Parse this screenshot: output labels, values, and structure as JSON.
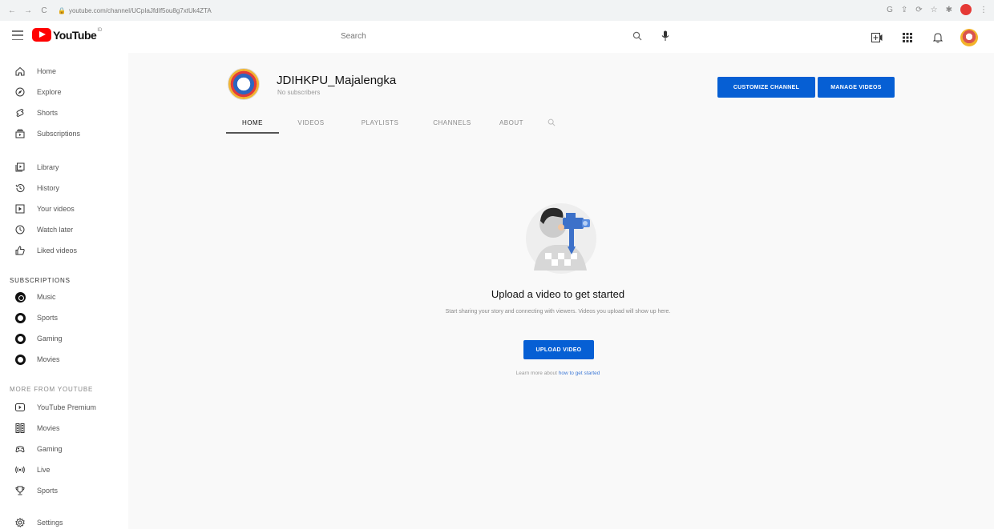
{
  "browser": {
    "url": "youtube.com/channel/UCpIaJfdIf5ou8g7xtUk4ZTA"
  },
  "header": {
    "logo_text": "YouTube",
    "logo_sup": "ID",
    "search_placeholder": "Search"
  },
  "sidebar": {
    "main": [
      {
        "label": "Home",
        "icon": "home-icon"
      },
      {
        "label": "Explore",
        "icon": "explore-icon"
      },
      {
        "label": "Shorts",
        "icon": "shorts-icon"
      },
      {
        "label": "Subscriptions",
        "icon": "subscriptions-icon"
      }
    ],
    "library": [
      {
        "label": "Library",
        "icon": "library-icon"
      },
      {
        "label": "History",
        "icon": "history-icon"
      },
      {
        "label": "Your videos",
        "icon": "your-videos-icon"
      },
      {
        "label": "Watch later",
        "icon": "watch-later-icon"
      },
      {
        "label": "Liked videos",
        "icon": "liked-videos-icon"
      }
    ],
    "subscriptions_heading": "SUBSCRIPTIONS",
    "subscriptions": [
      {
        "label": "Music"
      },
      {
        "label": "Sports"
      },
      {
        "label": "Gaming"
      },
      {
        "label": "Movies"
      }
    ],
    "more_heading": "MORE FROM YOUTUBE",
    "more": [
      {
        "label": "YouTube Premium",
        "icon": "youtube-premium-icon"
      },
      {
        "label": "Movies",
        "icon": "movies-icon"
      },
      {
        "label": "Gaming",
        "icon": "gaming-icon"
      },
      {
        "label": "Live",
        "icon": "live-icon"
      },
      {
        "label": "Sports",
        "icon": "sports-icon"
      }
    ],
    "settings": "Settings"
  },
  "channel": {
    "name": "JDIHKPU_Majalengka",
    "subscribers": "No subscribers",
    "customize_label": "CUSTOMIZE CHANNEL",
    "manage_label": "MANAGE VIDEOS",
    "tabs": [
      "HOME",
      "VIDEOS",
      "PLAYLISTS",
      "CHANNELS",
      "ABOUT"
    ],
    "active_tab": "HOME"
  },
  "empty_state": {
    "title": "Upload a video to get started",
    "description": "Start sharing your story and connecting with viewers. Videos you upload will show up here.",
    "upload_label": "UPLOAD VIDEO",
    "learn_prefix": "Learn more about ",
    "learn_link": "how to get started"
  },
  "colors": {
    "accent": "#065fd4",
    "brand": "#ff0000"
  }
}
